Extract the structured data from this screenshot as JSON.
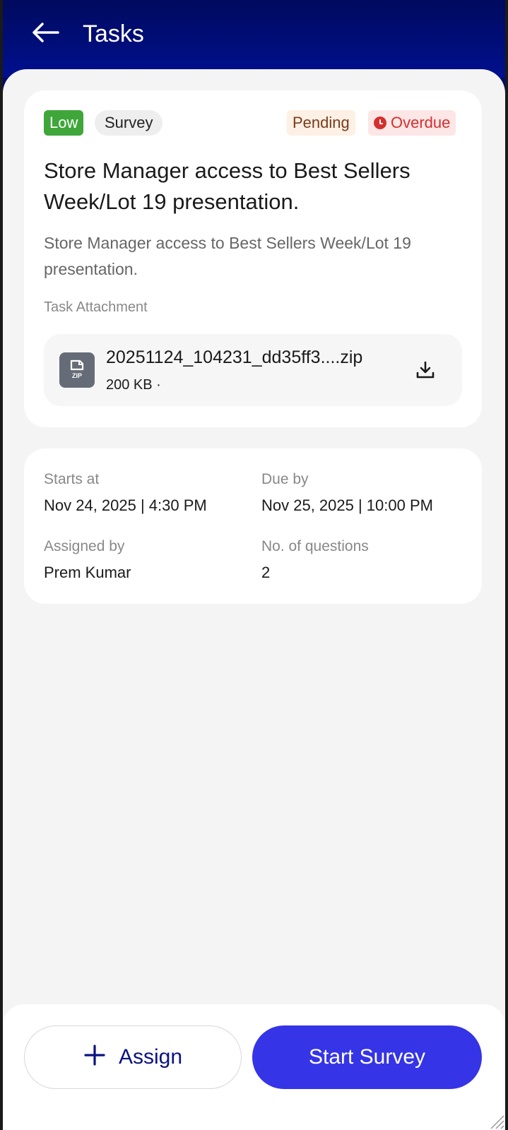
{
  "header": {
    "title": "Tasks"
  },
  "task": {
    "tags": {
      "priority": "Low",
      "type": "Survey",
      "status": "Pending",
      "overdue": "Overdue"
    },
    "title": "Store Manager access to Best Sellers Week/Lot 19 presentation.",
    "description": "Store Manager access to Best Sellers Week/Lot 19 presentation.",
    "attachment_label": "Task Attachment",
    "attachment": {
      "file_name": "20251124_104231_dd35ff3....zip",
      "file_size": "200 KB ·",
      "file_type": "ZIP"
    }
  },
  "details": {
    "starts_label": "Starts at",
    "starts_value": "Nov 24, 2025 | 4:30 PM",
    "due_label": "Due by",
    "due_value": "Nov 25, 2025 | 10:00 PM",
    "assigned_label": "Assigned by",
    "assigned_value": "Prem Kumar",
    "questions_label": "No. of questions",
    "questions_value": "2"
  },
  "actions": {
    "assign_label": "Assign",
    "start_label": "Start Survey"
  },
  "colors": {
    "header_bg": "#000b6b",
    "priority_low": "#3fa63a",
    "overdue_red": "#d32f2f",
    "primary_button": "#3534e6",
    "assign_text": "#0b1380"
  },
  "icons": {
    "back": "arrow-left-icon",
    "download": "download-icon",
    "file": "zip-file-icon",
    "overdue": "clock-icon",
    "assign": "plus-icon"
  }
}
